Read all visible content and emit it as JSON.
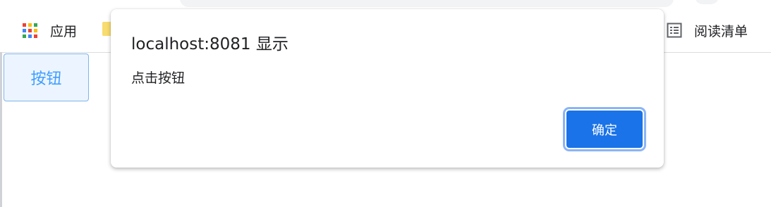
{
  "bookmarks_bar": {
    "apps_label": "应用",
    "apps_icon": "apps-grid-icon",
    "folder_icon": "folder-icon",
    "reading_list_label": "阅读清单",
    "reading_list_icon": "reading-list-icon"
  },
  "page": {
    "button_label": "按钮"
  },
  "alert_dialog": {
    "title": "localhost:8081 显示",
    "message": "点击按钮",
    "ok_label": "确定"
  },
  "colors": {
    "accent": "#1a73e8",
    "page_button_text": "#409eff",
    "page_button_bg": "#ecf5ff",
    "apps_grid": [
      "#ea4335",
      "#fbbc04",
      "#34a853",
      "#4285f4",
      "#ea4335",
      "#fbbc04",
      "#34a853",
      "#4285f4",
      "#ea4335"
    ]
  }
}
